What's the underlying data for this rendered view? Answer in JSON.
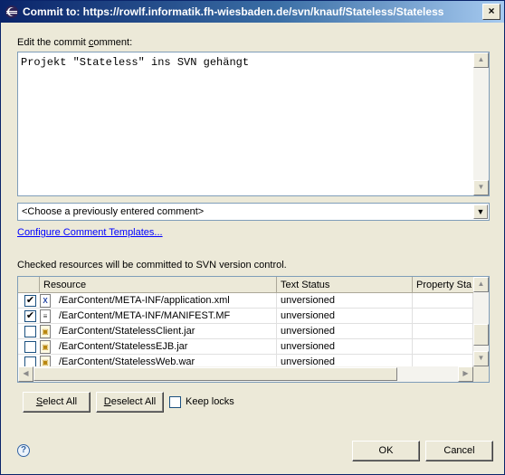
{
  "window": {
    "title": "Commit to: https://rowlf.informatik.fh-wiesbaden.de/svn/knauf/Stateless/Stateless",
    "close_glyph": "×"
  },
  "comment": {
    "label_pre": "Edit the commit ",
    "label_accel": "c",
    "label_post": "omment:",
    "text": "Projekt \"Stateless\" ins SVN gehängt"
  },
  "previous_comments": {
    "selected": "<Choose a previously entered comment>"
  },
  "templates_link": "Configure Comment Templates...",
  "resources": {
    "label": "Checked resources will be committed to SVN version control.",
    "columns": [
      "Resource",
      "Text Status",
      "Property Sta"
    ],
    "rows": [
      {
        "checked": true,
        "icon": "xml-file-icon",
        "path": "/EarContent/META-INF/application.xml",
        "status": "unversioned"
      },
      {
        "checked": true,
        "icon": "text-file-icon",
        "path": "/EarContent/META-INF/MANIFEST.MF",
        "status": "unversioned"
      },
      {
        "checked": false,
        "icon": "jar-file-icon",
        "path": "/EarContent/StatelessClient.jar",
        "status": "unversioned"
      },
      {
        "checked": false,
        "icon": "jar-file-icon",
        "path": "/EarContent/StatelessEJB.jar",
        "status": "unversioned"
      },
      {
        "checked": false,
        "icon": "jar-file-icon",
        "path": "/EarContent/StatelessWeb.war",
        "status": "unversioned"
      }
    ]
  },
  "buttons": {
    "select_all_accel": "S",
    "select_all_rest": "elect All",
    "deselect_all_accel": "D",
    "deselect_all_rest": "eselect All",
    "keep_locks": "Keep locks",
    "ok": "OK",
    "cancel": "Cancel",
    "help_glyph": "?"
  },
  "colors": {
    "title_bar": "#0a246a",
    "link": "#0000ff",
    "dialog_bg": "#ece9d8"
  }
}
